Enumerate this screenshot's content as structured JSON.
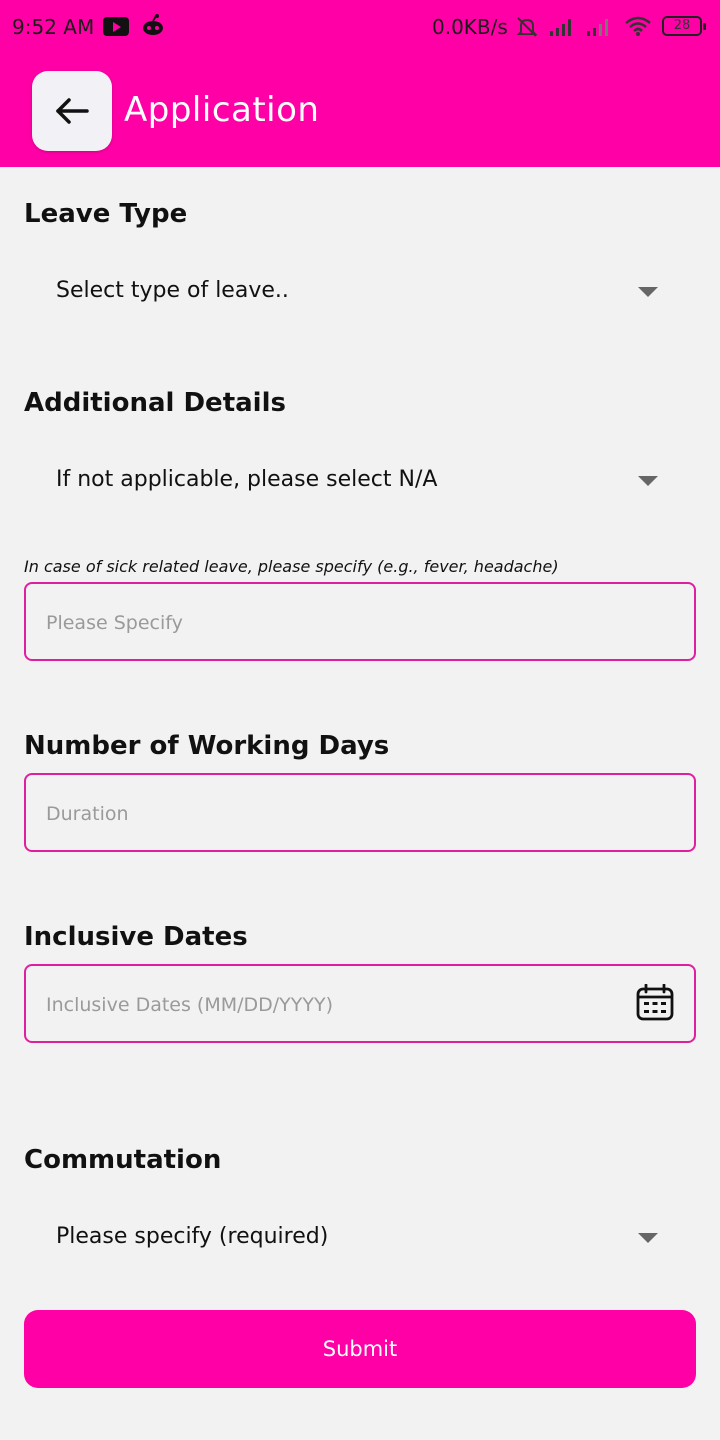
{
  "status_bar": {
    "time": "9:52 AM",
    "net_speed": "0.0KB/s",
    "battery": "28",
    "icons": [
      "youtube-icon",
      "bot-icon",
      "mute-icon",
      "signal-icon",
      "signal-icon",
      "wifi-icon",
      "battery-icon"
    ]
  },
  "header": {
    "title": "Application",
    "back_icon": "arrow-left-icon"
  },
  "form": {
    "leave_type": {
      "label": "Leave Type",
      "selected": "Select type of leave.."
    },
    "additional_details": {
      "label": "Additional Details",
      "selected": "If not applicable, please select N/A",
      "hint": "In case of sick related leave, please specify (e.g., fever, headache)",
      "specify_placeholder": "Please Specify"
    },
    "working_days": {
      "label": "Number of Working Days",
      "placeholder": "Duration"
    },
    "inclusive_dates": {
      "label": "Inclusive Dates",
      "placeholder": "Inclusive Dates (MM/DD/YYYY)",
      "icon": "calendar-icon"
    },
    "commutation": {
      "label": "Commutation",
      "selected": "Please specify (required)"
    },
    "submit_label": "Submit"
  },
  "colors": {
    "accent": "#ff00a6",
    "field_border": "#e01ea0",
    "background": "#f2f2f2"
  }
}
